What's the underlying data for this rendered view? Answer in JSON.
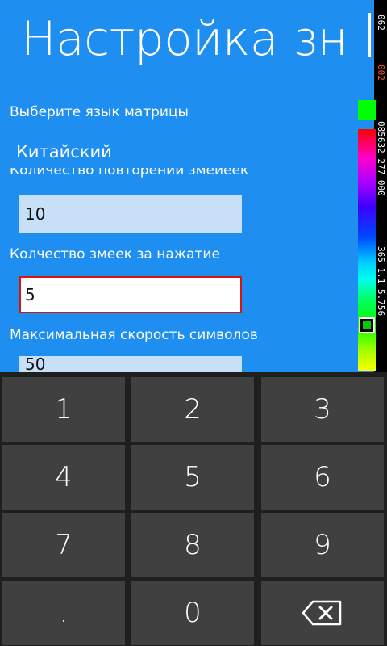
{
  "page": {
    "title": "Настройка знач"
  },
  "form": {
    "language_label": "Выберите язык матрицы",
    "language_value": "Китайский",
    "repeat_label": "Количество повторений змейеек",
    "repeat_value": "10",
    "snakes_label": "Колчество  змеек за нажатие",
    "snakes_value": "5",
    "speed_label": "Максимальная скорость символов",
    "speed_value": "50"
  },
  "overlay": {
    "counter_top": "062",
    "counter_red": "002",
    "counter_mid": "085632 277 000",
    "counter_bottom": "365 1.1 5.756",
    "accent_color": "#00ff00"
  },
  "keyboard": {
    "keys": [
      "1",
      "2",
      "3",
      "4",
      "5",
      "6",
      "7",
      "8",
      "9",
      ".",
      "0",
      "backspace"
    ],
    "backspace_icon": "backspace-icon"
  },
  "colors": {
    "background": "#1e8ef0",
    "textbox": "#c7e0f8",
    "focus_border": "#d8140f",
    "key": "#404040",
    "keyboard_bg": "#1f1f1f"
  }
}
